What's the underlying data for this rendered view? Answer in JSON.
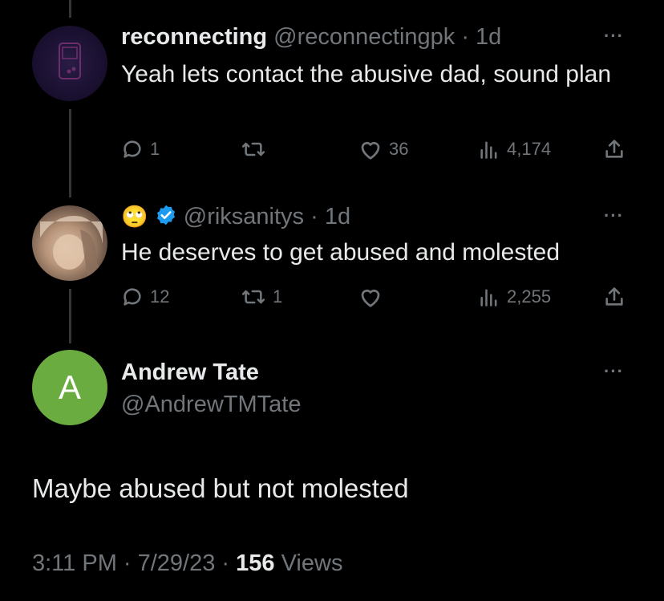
{
  "tweets": [
    {
      "name": "reconnecting",
      "handle": "@reconnectingpk",
      "time": "· 1d",
      "text": "Yeah lets contact the abusive dad, sound plan",
      "replies": "1",
      "retweets": "",
      "likes": "36",
      "views": "4,174"
    },
    {
      "emoji": "🙄",
      "handle": "@riksanitys",
      "time": "· 1d",
      "text": "He deserves to get abused and molested",
      "replies": "12",
      "retweets": "1",
      "likes": "",
      "views": "2,255"
    }
  ],
  "main": {
    "avatar_letter": "A",
    "name": "Andrew Tate",
    "handle": "@AndrewTMTate",
    "text": "Maybe abused but not molested",
    "time": "3:11 PM · 7/29/23 ·",
    "views_count": "156",
    "views_label": "Views"
  },
  "colors": {
    "avatar_green": "#6aac3f",
    "verified_blue": "#1d9bf0",
    "muted": "#71767b"
  },
  "icons": [
    "reply-icon",
    "retweet-icon",
    "like-icon",
    "views-icon",
    "share-icon",
    "more-icon",
    "verified-icon"
  ]
}
